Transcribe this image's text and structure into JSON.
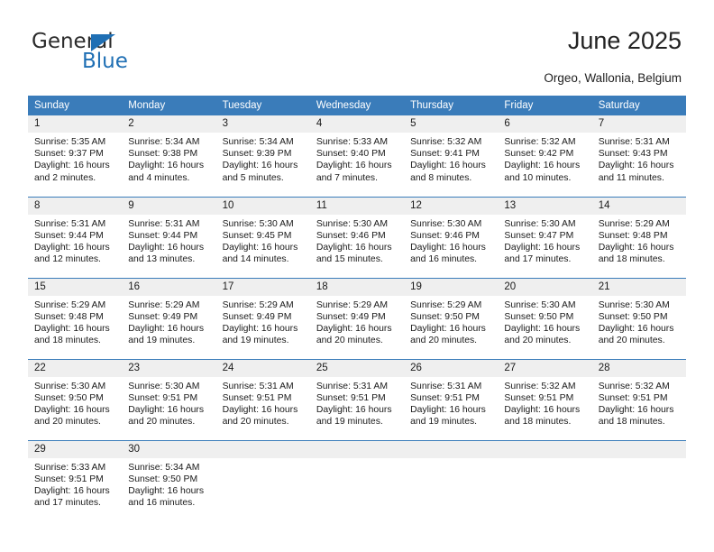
{
  "brand": {
    "name_part1": "General",
    "name_part2": "Blue",
    "accent_color": "#1f6fb4",
    "triangle_icon": "triangle-icon"
  },
  "header": {
    "title": "June 2025",
    "location": "Orgeo, Wallonia, Belgium"
  },
  "calendar": {
    "header_bg": "#3a7cba",
    "daynum_bg": "#efefef",
    "weekday_headers": [
      "Sunday",
      "Monday",
      "Tuesday",
      "Wednesday",
      "Thursday",
      "Friday",
      "Saturday"
    ],
    "weeks": [
      [
        {
          "day": "1",
          "sunrise": "Sunrise: 5:35 AM",
          "sunset": "Sunset: 9:37 PM",
          "daylight1": "Daylight: 16 hours",
          "daylight2": "and 2 minutes."
        },
        {
          "day": "2",
          "sunrise": "Sunrise: 5:34 AM",
          "sunset": "Sunset: 9:38 PM",
          "daylight1": "Daylight: 16 hours",
          "daylight2": "and 4 minutes."
        },
        {
          "day": "3",
          "sunrise": "Sunrise: 5:34 AM",
          "sunset": "Sunset: 9:39 PM",
          "daylight1": "Daylight: 16 hours",
          "daylight2": "and 5 minutes."
        },
        {
          "day": "4",
          "sunrise": "Sunrise: 5:33 AM",
          "sunset": "Sunset: 9:40 PM",
          "daylight1": "Daylight: 16 hours",
          "daylight2": "and 7 minutes."
        },
        {
          "day": "5",
          "sunrise": "Sunrise: 5:32 AM",
          "sunset": "Sunset: 9:41 PM",
          "daylight1": "Daylight: 16 hours",
          "daylight2": "and 8 minutes."
        },
        {
          "day": "6",
          "sunrise": "Sunrise: 5:32 AM",
          "sunset": "Sunset: 9:42 PM",
          "daylight1": "Daylight: 16 hours",
          "daylight2": "and 10 minutes."
        },
        {
          "day": "7",
          "sunrise": "Sunrise: 5:31 AM",
          "sunset": "Sunset: 9:43 PM",
          "daylight1": "Daylight: 16 hours",
          "daylight2": "and 11 minutes."
        }
      ],
      [
        {
          "day": "8",
          "sunrise": "Sunrise: 5:31 AM",
          "sunset": "Sunset: 9:44 PM",
          "daylight1": "Daylight: 16 hours",
          "daylight2": "and 12 minutes."
        },
        {
          "day": "9",
          "sunrise": "Sunrise: 5:31 AM",
          "sunset": "Sunset: 9:44 PM",
          "daylight1": "Daylight: 16 hours",
          "daylight2": "and 13 minutes."
        },
        {
          "day": "10",
          "sunrise": "Sunrise: 5:30 AM",
          "sunset": "Sunset: 9:45 PM",
          "daylight1": "Daylight: 16 hours",
          "daylight2": "and 14 minutes."
        },
        {
          "day": "11",
          "sunrise": "Sunrise: 5:30 AM",
          "sunset": "Sunset: 9:46 PM",
          "daylight1": "Daylight: 16 hours",
          "daylight2": "and 15 minutes."
        },
        {
          "day": "12",
          "sunrise": "Sunrise: 5:30 AM",
          "sunset": "Sunset: 9:46 PM",
          "daylight1": "Daylight: 16 hours",
          "daylight2": "and 16 minutes."
        },
        {
          "day": "13",
          "sunrise": "Sunrise: 5:30 AM",
          "sunset": "Sunset: 9:47 PM",
          "daylight1": "Daylight: 16 hours",
          "daylight2": "and 17 minutes."
        },
        {
          "day": "14",
          "sunrise": "Sunrise: 5:29 AM",
          "sunset": "Sunset: 9:48 PM",
          "daylight1": "Daylight: 16 hours",
          "daylight2": "and 18 minutes."
        }
      ],
      [
        {
          "day": "15",
          "sunrise": "Sunrise: 5:29 AM",
          "sunset": "Sunset: 9:48 PM",
          "daylight1": "Daylight: 16 hours",
          "daylight2": "and 18 minutes."
        },
        {
          "day": "16",
          "sunrise": "Sunrise: 5:29 AM",
          "sunset": "Sunset: 9:49 PM",
          "daylight1": "Daylight: 16 hours",
          "daylight2": "and 19 minutes."
        },
        {
          "day": "17",
          "sunrise": "Sunrise: 5:29 AM",
          "sunset": "Sunset: 9:49 PM",
          "daylight1": "Daylight: 16 hours",
          "daylight2": "and 19 minutes."
        },
        {
          "day": "18",
          "sunrise": "Sunrise: 5:29 AM",
          "sunset": "Sunset: 9:49 PM",
          "daylight1": "Daylight: 16 hours",
          "daylight2": "and 20 minutes."
        },
        {
          "day": "19",
          "sunrise": "Sunrise: 5:29 AM",
          "sunset": "Sunset: 9:50 PM",
          "daylight1": "Daylight: 16 hours",
          "daylight2": "and 20 minutes."
        },
        {
          "day": "20",
          "sunrise": "Sunrise: 5:30 AM",
          "sunset": "Sunset: 9:50 PM",
          "daylight1": "Daylight: 16 hours",
          "daylight2": "and 20 minutes."
        },
        {
          "day": "21",
          "sunrise": "Sunrise: 5:30 AM",
          "sunset": "Sunset: 9:50 PM",
          "daylight1": "Daylight: 16 hours",
          "daylight2": "and 20 minutes."
        }
      ],
      [
        {
          "day": "22",
          "sunrise": "Sunrise: 5:30 AM",
          "sunset": "Sunset: 9:50 PM",
          "daylight1": "Daylight: 16 hours",
          "daylight2": "and 20 minutes."
        },
        {
          "day": "23",
          "sunrise": "Sunrise: 5:30 AM",
          "sunset": "Sunset: 9:51 PM",
          "daylight1": "Daylight: 16 hours",
          "daylight2": "and 20 minutes."
        },
        {
          "day": "24",
          "sunrise": "Sunrise: 5:31 AM",
          "sunset": "Sunset: 9:51 PM",
          "daylight1": "Daylight: 16 hours",
          "daylight2": "and 20 minutes."
        },
        {
          "day": "25",
          "sunrise": "Sunrise: 5:31 AM",
          "sunset": "Sunset: 9:51 PM",
          "daylight1": "Daylight: 16 hours",
          "daylight2": "and 19 minutes."
        },
        {
          "day": "26",
          "sunrise": "Sunrise: 5:31 AM",
          "sunset": "Sunset: 9:51 PM",
          "daylight1": "Daylight: 16 hours",
          "daylight2": "and 19 minutes."
        },
        {
          "day": "27",
          "sunrise": "Sunrise: 5:32 AM",
          "sunset": "Sunset: 9:51 PM",
          "daylight1": "Daylight: 16 hours",
          "daylight2": "and 18 minutes."
        },
        {
          "day": "28",
          "sunrise": "Sunrise: 5:32 AM",
          "sunset": "Sunset: 9:51 PM",
          "daylight1": "Daylight: 16 hours",
          "daylight2": "and 18 minutes."
        }
      ],
      [
        {
          "day": "29",
          "sunrise": "Sunrise: 5:33 AM",
          "sunset": "Sunset: 9:51 PM",
          "daylight1": "Daylight: 16 hours",
          "daylight2": "and 17 minutes."
        },
        {
          "day": "30",
          "sunrise": "Sunrise: 5:34 AM",
          "sunset": "Sunset: 9:50 PM",
          "daylight1": "Daylight: 16 hours",
          "daylight2": "and 16 minutes."
        },
        {
          "day": "",
          "sunrise": "",
          "sunset": "",
          "daylight1": "",
          "daylight2": ""
        },
        {
          "day": "",
          "sunrise": "",
          "sunset": "",
          "daylight1": "",
          "daylight2": ""
        },
        {
          "day": "",
          "sunrise": "",
          "sunset": "",
          "daylight1": "",
          "daylight2": ""
        },
        {
          "day": "",
          "sunrise": "",
          "sunset": "",
          "daylight1": "",
          "daylight2": ""
        },
        {
          "day": "",
          "sunrise": "",
          "sunset": "",
          "daylight1": "",
          "daylight2": ""
        }
      ]
    ]
  }
}
